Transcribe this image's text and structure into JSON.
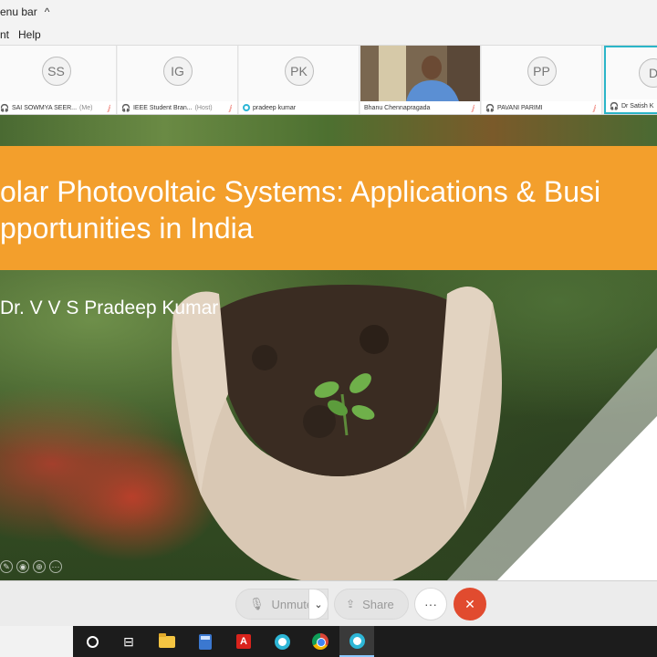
{
  "window": {
    "title": "enu bar",
    "chevron": "^"
  },
  "menu": {
    "items": [
      "nt",
      "Help"
    ]
  },
  "participants": [
    {
      "initials": "SS",
      "name": "SAI SOWMYA SEER...",
      "suffix": "(Me)",
      "muted": true,
      "icon": "headphone-icon"
    },
    {
      "initials": "IG",
      "name": "IEEE Student Bran...",
      "suffix": "(Host)",
      "muted": true,
      "icon": "headphone-icon"
    },
    {
      "initials": "PK",
      "name": "pradeep kumar",
      "suffix": "",
      "muted": false,
      "icon": "app-ring-icon"
    },
    {
      "initials": "",
      "name": "Bhanu Chennapragada",
      "suffix": "",
      "muted": true,
      "icon": "none",
      "video": true
    },
    {
      "initials": "PP",
      "name": "PAVANI PARIMI",
      "suffix": "",
      "muted": true,
      "icon": "headphone-icon"
    },
    {
      "initials": "D",
      "name": "Dr Satish K",
      "suffix": "",
      "muted": false,
      "icon": "headphone-icon",
      "active": true
    }
  ],
  "slide": {
    "title_line1": "olar Photovoltaic Systems: Applications & Busi",
    "title_line2": "pportunities in India",
    "author": "Dr. V V S Pradeep Kumar",
    "banner_color": "#f39f2c"
  },
  "controls": {
    "unmute": "Unmute",
    "share": "Share",
    "more": "···",
    "leave": "✕",
    "leave_color": "#e14b2f"
  },
  "taskbar": {
    "icons": [
      "cortana-icon",
      "task-view-icon",
      "file-explorer-icon",
      "calculator-icon",
      "acrobat-icon",
      "meeting-app-icon",
      "chrome-icon",
      "meeting-app-icon"
    ]
  }
}
